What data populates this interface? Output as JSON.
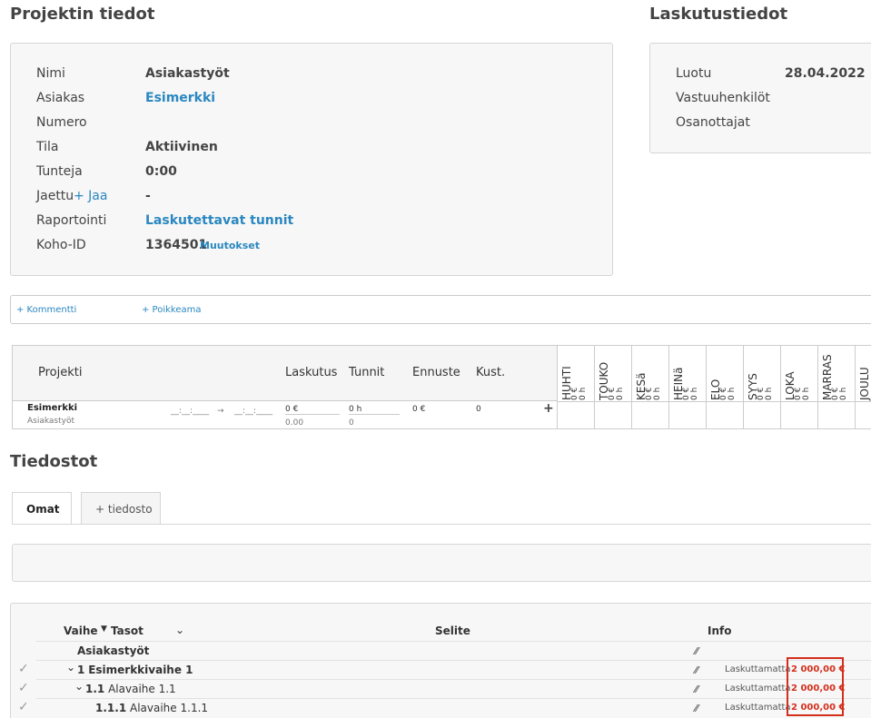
{
  "project_info": {
    "title": "Projektin tiedot",
    "rows": [
      {
        "label": "Nimi",
        "value": "Asiakastyöt",
        "link": false
      },
      {
        "label": "Asiakas",
        "value": "Esimerkki",
        "link": true
      },
      {
        "label": "Numero",
        "value": "",
        "link": false
      },
      {
        "label": "Tila",
        "value": "Aktiivinen",
        "link": false
      },
      {
        "label": "Tunteja",
        "value": "0:00",
        "link": false
      },
      {
        "label": "Jaettu",
        "value": "-",
        "link": false
      },
      {
        "label": "Raportointi",
        "value": "Laskutettavat tunnit",
        "link": true
      },
      {
        "label": "Koho-ID",
        "value": "1364501",
        "link": false
      }
    ],
    "share_link": "+ Jaa",
    "changes_link": "Muutokset"
  },
  "billing_info": {
    "title": "Laskutustiedot",
    "rows": [
      {
        "label": "Luotu",
        "value": "28.04.2022"
      },
      {
        "label": "Vastuuhenkilöt",
        "value": ""
      },
      {
        "label": "Osanottajat",
        "value": ""
      }
    ]
  },
  "comment_bar": {
    "comment_link": "+ Kommentti",
    "deviation_link": "+ Poikkeama"
  },
  "budget_table": {
    "headers": {
      "project": "Projekti",
      "billing": "Laskutus",
      "hours": "Tunnit",
      "forecast": "Ennuste",
      "cost": "Kust."
    },
    "months": [
      {
        "name": "HUHTI",
        "eur": "0 €",
        "hours": "0 h"
      },
      {
        "name": "TOUKO",
        "eur": "0 €",
        "hours": "0 h"
      },
      {
        "name": "KESä",
        "eur": "0 €",
        "hours": "0 h"
      },
      {
        "name": "HEINä",
        "eur": "0 €",
        "hours": "0 h"
      },
      {
        "name": "ELO",
        "eur": "0 €",
        "hours": "0 h"
      },
      {
        "name": "SYYS",
        "eur": "0 €",
        "hours": "0 h"
      },
      {
        "name": "LOKA",
        "eur": "0 €",
        "hours": "0 h"
      },
      {
        "name": "MARRAS",
        "eur": "0 €",
        "hours": "0 h"
      },
      {
        "name": "JOULU",
        "eur": "",
        "hours": ""
      }
    ],
    "row": {
      "customer": "Esimerkki",
      "project": "Asiakastyöt",
      "date_from": "__:__:____",
      "arrow": "→",
      "date_to": "__:__:____",
      "billing": "0 €",
      "billing_sub": "0.00",
      "hours": "0 h",
      "hours_sub": "0",
      "forecast": "0 €",
      "cost": "0"
    }
  },
  "files": {
    "title": "Tiedostot",
    "tabs": [
      "Omat",
      "+ tiedosto"
    ]
  },
  "phases": {
    "headers": {
      "phase": "Vaihe",
      "levels": "Tasot",
      "description": "Selite",
      "info": "Info"
    },
    "project_row": "Asiakastyöt",
    "rows": [
      {
        "code": "1",
        "name": "Esimerkkivaihe 1",
        "status": "Laskuttamatta",
        "amount": "2 000,00 €"
      },
      {
        "code": "1.1",
        "name": "Alavaihe 1.1",
        "status": "Laskuttamatta",
        "amount": "2 000,00 €"
      },
      {
        "code": "1.1.1",
        "name": "Alavaihe 1.1.1",
        "status": "Laskuttamatta",
        "amount": "2 000,00 €"
      }
    ]
  },
  "colors": {
    "link": "#2a87c0",
    "highlight": "#d32f1c"
  }
}
